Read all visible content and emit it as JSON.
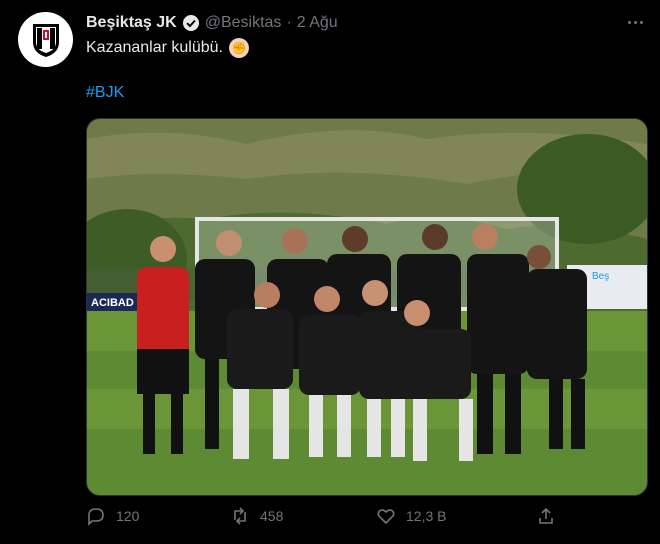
{
  "tweet": {
    "author_name": "Beşiktaş JK",
    "handle": "@Besiktas",
    "separator": "·",
    "time": "2 Ağu",
    "text": "Kazananlar kulübü.",
    "emoji": "fist-emoji",
    "hashtag": "#BJK",
    "media": {
      "alt_description": "team-photo-celebrating",
      "banner_text_left": "ACIBAD",
      "banner_text_right": "Beş"
    }
  },
  "actions": {
    "reply_count": "120",
    "retweet_count": "458",
    "like_count": "12,3 B"
  },
  "colors": {
    "background": "#000000",
    "text": "#e7e9ea",
    "muted": "#71767b",
    "link": "#1d9bf0"
  }
}
